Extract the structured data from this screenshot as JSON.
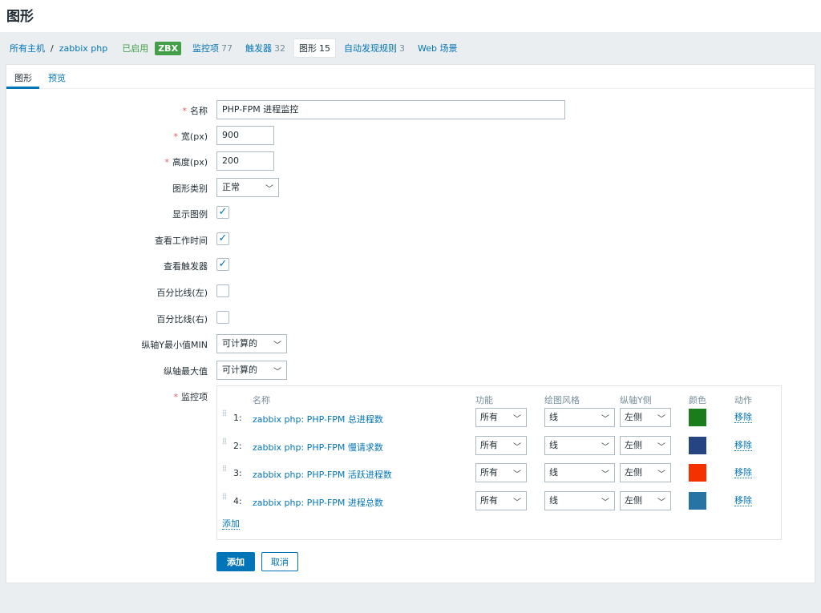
{
  "page": {
    "title": "图形"
  },
  "breadcrumb": {
    "all_hosts": "所有主机",
    "separator": "/",
    "host": "zabbix php",
    "status": "已启用",
    "badge": "ZBX",
    "nav": [
      {
        "label": "监控项",
        "count": "77"
      },
      {
        "label": "触发器",
        "count": "32"
      },
      {
        "label": "图形",
        "count": "15"
      },
      {
        "label": "自动发现规则",
        "count": "3"
      },
      {
        "label": "Web 场景",
        "count": ""
      }
    ]
  },
  "tabs": {
    "graph": "图形",
    "preview": "预览"
  },
  "form": {
    "required_mark": "*",
    "name_label": "名称",
    "name_value": "PHP-FPM 进程监控",
    "width_label": "宽(px)",
    "width_value": "900",
    "height_label": "高度(px)",
    "height_value": "200",
    "graph_type_label": "图形类别",
    "graph_type_value": "正常",
    "show_legend_label": "显示图例",
    "show_working_time_label": "查看工作时间",
    "show_triggers_label": "查看触发器",
    "percentile_left_label": "百分比线(左)",
    "percentile_right_label": "百分比线(右)",
    "ymin_label": "纵轴Y最小值MIN",
    "ymin_value": "可计算的",
    "ymax_label": "纵轴最大值",
    "ymax_value": "可计算的",
    "items_label": "监控项",
    "checked_glyph": "✓",
    "chevron_glyph": "﹀",
    "drag_glyph": "⁞⁞"
  },
  "checkboxes": {
    "show_legend": true,
    "show_working_time": true,
    "show_triggers": true,
    "percentile_left": false,
    "percentile_right": false
  },
  "items_table": {
    "headers": {
      "name": "名称",
      "function": "功能",
      "draw_style": "绘图风格",
      "y_axis": "纵轴Y侧",
      "color": "颜色",
      "action": "动作"
    },
    "rows": [
      {
        "num": "1:",
        "name": "zabbix php: PHP-FPM 总进程数",
        "function": "所有",
        "draw_style": "线",
        "y_axis": "左侧",
        "color": "#1a7c1a",
        "action": "移除"
      },
      {
        "num": "2:",
        "name": "zabbix php: PHP-FPM 慢请求数",
        "function": "所有",
        "draw_style": "线",
        "y_axis": "左侧",
        "color": "#274482",
        "action": "移除"
      },
      {
        "num": "3:",
        "name": "zabbix php: PHP-FPM 活跃进程数",
        "function": "所有",
        "draw_style": "线",
        "y_axis": "左侧",
        "color": "#f63100",
        "action": "移除"
      },
      {
        "num": "4:",
        "name": "zabbix php: PHP-FPM 进程总数",
        "function": "所有",
        "draw_style": "线",
        "y_axis": "左侧",
        "color": "#2774a4",
        "action": "移除"
      }
    ],
    "add_link": "添加"
  },
  "buttons": {
    "add": "添加",
    "cancel": "取消"
  }
}
